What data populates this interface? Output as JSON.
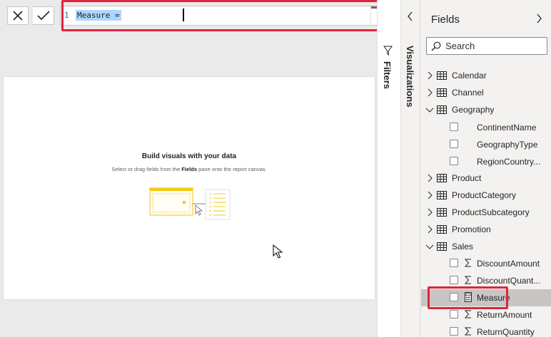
{
  "formula_bar": {
    "line_number": "1",
    "code": "Measure = "
  },
  "canvas": {
    "empty_title": "Build visuals with your data",
    "empty_sub_pre": "Select or drag fields from the ",
    "empty_sub_bold": "Fields",
    "empty_sub_post": " pane onto the report canvas."
  },
  "panes": {
    "filters_label": "Filters",
    "visualizations_label": "Visualizations"
  },
  "fields": {
    "title": "Fields",
    "search_placeholder": "Search",
    "tables": [
      {
        "label": "Calendar",
        "expanded": false
      },
      {
        "label": "Channel",
        "expanded": false
      },
      {
        "label": "Geography",
        "expanded": true
      },
      {
        "label": "ContinentName",
        "field": true,
        "icon": "none"
      },
      {
        "label": "GeographyType",
        "field": true,
        "icon": "none"
      },
      {
        "label": "RegionCountry...",
        "field": true,
        "icon": "none"
      },
      {
        "label": "Product",
        "expanded": false
      },
      {
        "label": "ProductCategory",
        "expanded": false
      },
      {
        "label": "ProductSubcategory",
        "expanded": false
      },
      {
        "label": "Promotion",
        "expanded": false
      },
      {
        "label": "Sales",
        "expanded": true
      },
      {
        "label": "DiscountAmount",
        "field": true,
        "icon": "sigma"
      },
      {
        "label": "DiscountQuant...",
        "field": true,
        "icon": "sigma"
      },
      {
        "label": "Measure",
        "field": true,
        "icon": "calculator",
        "selected": true
      },
      {
        "label": "ReturnAmount",
        "field": true,
        "icon": "sigma"
      },
      {
        "label": "ReturnQuantity",
        "field": true,
        "icon": "sigma"
      }
    ]
  },
  "colors": {
    "highlight": "#e0243f",
    "accent": "#f2c811",
    "pane_bg": "#f3f2f1"
  }
}
